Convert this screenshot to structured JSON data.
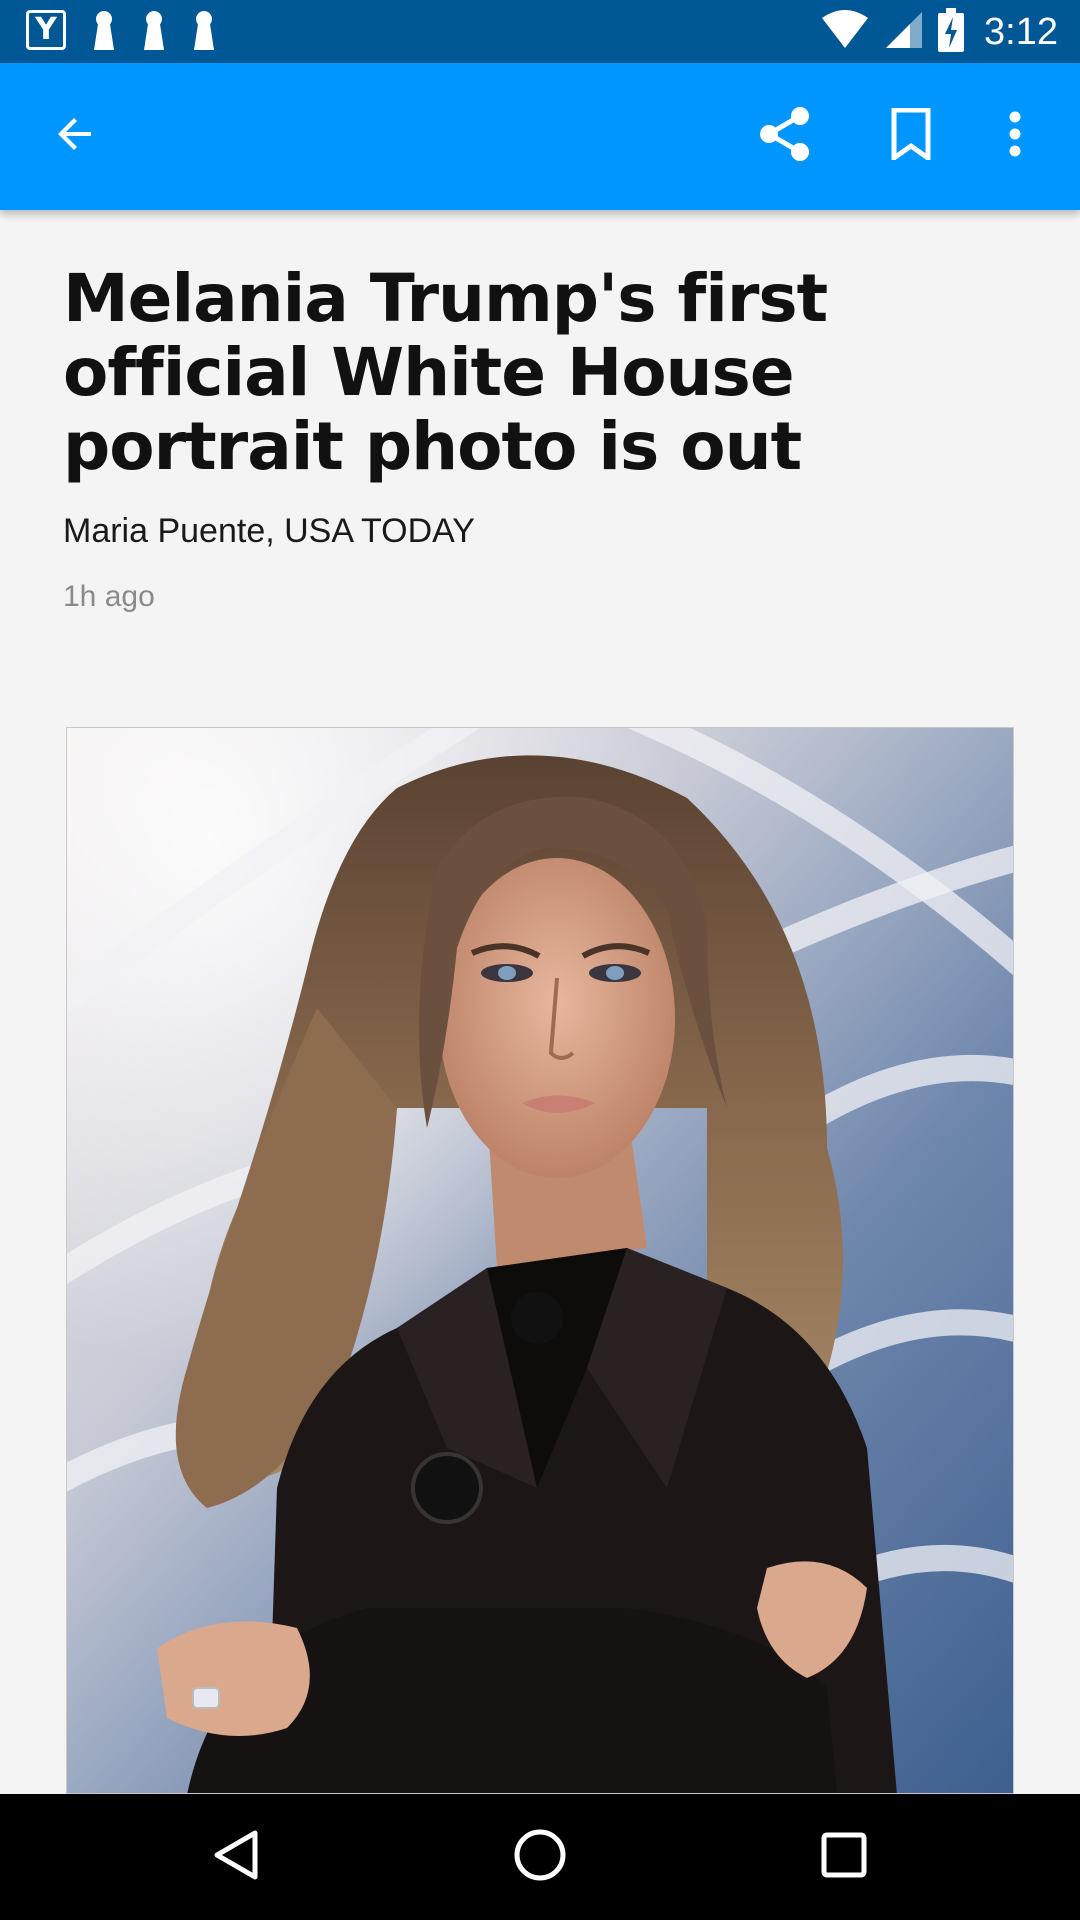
{
  "status_bar": {
    "app_icon_letter": "Y",
    "time": "3:12",
    "notification_icons": [
      "keyhole-icon",
      "keyhole-icon",
      "keyhole-icon"
    ],
    "indicators": [
      "wifi-icon",
      "cellular-signal-icon",
      "battery-charging-icon"
    ],
    "background_color": "#005796"
  },
  "app_bar": {
    "background_color": "#0096ff",
    "actions": [
      "back-arrow-icon",
      "share-icon",
      "bookmark-icon",
      "more-vertical-icon"
    ]
  },
  "article": {
    "headline": "Melania Trump's first official White House portrait photo is out",
    "byline": "Maria Puente, USA TODAY",
    "timestamp": "1h ago"
  },
  "nav_bar": {
    "buttons": [
      "nav-back-icon",
      "nav-home-icon",
      "nav-recents-icon"
    ]
  }
}
